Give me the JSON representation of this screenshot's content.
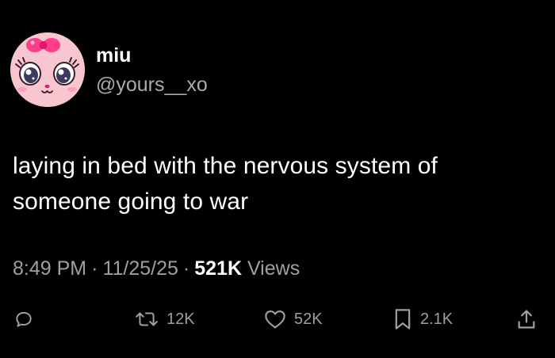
{
  "user": {
    "name": "miu",
    "handle": "@yours__xo",
    "avatar_icon": "pink-cat-face-with-bow-icon"
  },
  "tweet": {
    "text": "laying in bed with the nervous system of someone going to war"
  },
  "meta": {
    "time": "8:49 PM",
    "separator": "·",
    "date": "11/25/25",
    "views_count": "521K",
    "views_label": "Views"
  },
  "actions": {
    "reply": {
      "icon": "reply-bubble-icon"
    },
    "retweet": {
      "icon": "retweet-icon",
      "count": "12K"
    },
    "like": {
      "icon": "heart-icon",
      "count": "52K"
    },
    "bookmark": {
      "icon": "bookmark-icon",
      "count": "2.1K"
    },
    "share": {
      "icon": "share-upload-icon"
    }
  },
  "colors": {
    "background": "#000000",
    "primary_text": "#ffffff",
    "secondary_text": "#9aa0a6",
    "avatar_pink": "#f7c6cf"
  }
}
